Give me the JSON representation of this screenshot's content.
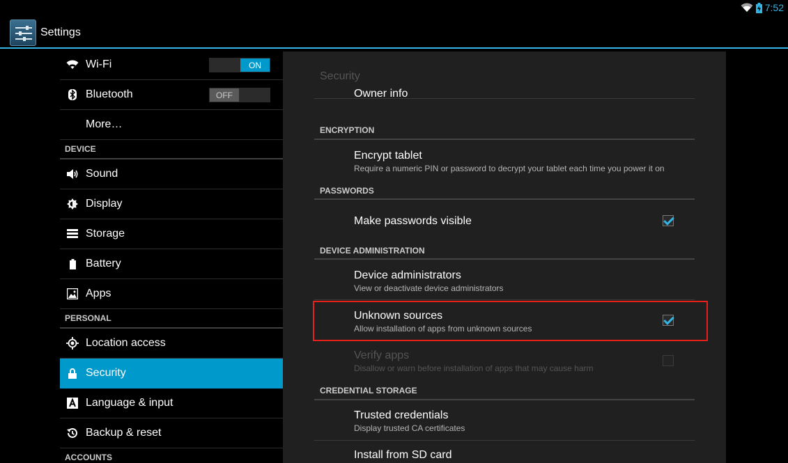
{
  "status_bar": {
    "time": "7:52",
    "icons": [
      "wifi-icon",
      "battery-charging-icon"
    ]
  },
  "action_bar": {
    "title": "Settings",
    "icon": "settings-sliders-icon"
  },
  "sidebar": {
    "items": [
      {
        "type": "item",
        "label": "Wi-Fi",
        "icon": "wifi-icon",
        "toggle": "ON"
      },
      {
        "type": "item",
        "label": "Bluetooth",
        "icon": "bluetooth-icon",
        "toggle": "OFF"
      },
      {
        "type": "item",
        "label": "More…",
        "icon": ""
      },
      {
        "type": "category",
        "label": "DEVICE"
      },
      {
        "type": "item",
        "label": "Sound",
        "icon": "speaker-icon"
      },
      {
        "type": "item",
        "label": "Display",
        "icon": "brightness-icon"
      },
      {
        "type": "item",
        "label": "Storage",
        "icon": "storage-icon"
      },
      {
        "type": "item",
        "label": "Battery",
        "icon": "battery-icon"
      },
      {
        "type": "item",
        "label": "Apps",
        "icon": "apps-icon"
      },
      {
        "type": "category",
        "label": "PERSONAL"
      },
      {
        "type": "item",
        "label": "Location access",
        "icon": "location-icon"
      },
      {
        "type": "item",
        "label": "Security",
        "icon": "lock-icon",
        "selected": true
      },
      {
        "type": "item",
        "label": "Language & input",
        "icon": "keyboard-a-icon"
      },
      {
        "type": "item",
        "label": "Backup & reset",
        "icon": "backup-icon"
      },
      {
        "type": "category",
        "label": "ACCOUNTS"
      }
    ]
  },
  "security": {
    "header": "Security",
    "owner_info": "Owner info",
    "encryption": {
      "category": "ENCRYPTION",
      "encrypt_title": "Encrypt tablet",
      "encrypt_summary": "Require a numeric PIN or password to decrypt your tablet each time you power it on"
    },
    "passwords": {
      "category": "PASSWORDS",
      "visible_title": "Make passwords visible",
      "visible_checked": true
    },
    "device_admin": {
      "category": "DEVICE ADMINISTRATION",
      "admins_title": "Device administrators",
      "admins_summary": "View or deactivate device administrators",
      "unknown_title": "Unknown sources",
      "unknown_summary": "Allow installation of apps from unknown sources",
      "unknown_checked": true,
      "verify_title": "Verify apps",
      "verify_summary": "Disallow or warn before installation of apps that may cause harm",
      "verify_checked": false
    },
    "credential_storage": {
      "category": "CREDENTIAL STORAGE",
      "trusted_title": "Trusted credentials",
      "trusted_summary": "Display trusted CA certificates",
      "install_title": "Install from SD card"
    }
  },
  "colors": {
    "accent": "#33b5e5",
    "selected": "#0099cc",
    "highlight": "#e8201a"
  }
}
